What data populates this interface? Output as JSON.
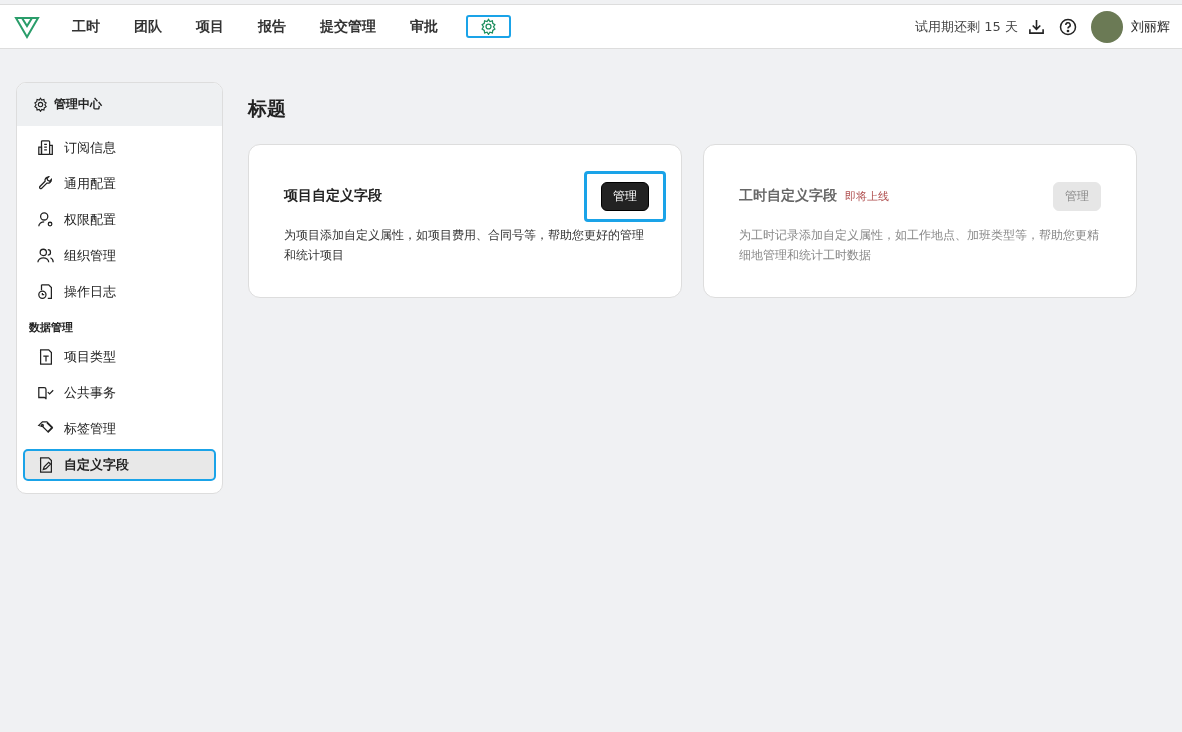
{
  "topbar": {
    "nav": [
      {
        "label": "工时",
        "kind": "text",
        "selected": false,
        "highlighted": false
      },
      {
        "label": "团队",
        "kind": "text",
        "selected": false,
        "highlighted": false
      },
      {
        "label": "项目",
        "kind": "text",
        "selected": false,
        "highlighted": false
      },
      {
        "label": "报告",
        "kind": "text",
        "selected": false,
        "highlighted": false
      },
      {
        "label": "提交管理",
        "kind": "text",
        "selected": false,
        "highlighted": false
      },
      {
        "label": "审批",
        "kind": "text",
        "selected": false,
        "highlighted": false
      },
      {
        "kind": "settings",
        "selected": true,
        "highlighted": true
      }
    ],
    "trial": "试用期还剩 15 天",
    "user": "刘丽辉"
  },
  "sidebar": {
    "title": "管理中心",
    "groups": [
      {
        "items": [
          {
            "label": "订阅信息",
            "kind": "building",
            "selected": false,
            "highlighted": false
          },
          {
            "label": "通用配置",
            "kind": "wrench",
            "selected": false,
            "highlighted": false
          },
          {
            "label": "权限配置",
            "kind": "user-gear",
            "selected": false,
            "highlighted": false
          },
          {
            "label": "组织管理",
            "kind": "users",
            "selected": false,
            "highlighted": false
          },
          {
            "label": "操作日志",
            "kind": "log",
            "selected": false,
            "highlighted": false
          }
        ]
      },
      {
        "label": "数据管理",
        "items": [
          {
            "label": "项目类型",
            "kind": "doc-t",
            "selected": false,
            "highlighted": false
          },
          {
            "label": "公共事务",
            "kind": "book",
            "selected": false,
            "highlighted": false
          },
          {
            "label": "标签管理",
            "kind": "tag",
            "selected": false,
            "highlighted": false
          },
          {
            "label": "自定义字段",
            "kind": "doc-edit",
            "selected": true,
            "highlighted": true
          }
        ]
      }
    ]
  },
  "main": {
    "heading": "标题",
    "cards": [
      {
        "title": "项目自定义字段",
        "button": "管理",
        "disabled": false,
        "highlighted": true,
        "description": "为项目添加自定义属性，如项目费用、合同号等，帮助您更好的管理和统计项目"
      },
      {
        "title": "工时自定义字段",
        "badge": "即将上线",
        "button": "管理",
        "disabled": true,
        "highlighted": false,
        "description": "为工时记录添加自定义属性，如工作地点、加班类型等，帮助您更精细地管理和统计工时数据"
      }
    ]
  }
}
